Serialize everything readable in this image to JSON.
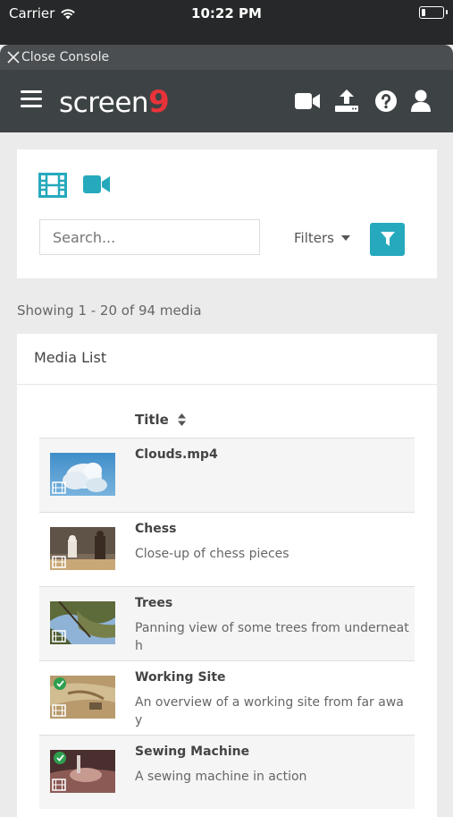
{
  "status_bar": {
    "carrier": "Carrier",
    "time": "10:22 PM"
  },
  "console": {
    "close_label": "Close Console"
  },
  "app": {
    "logo_text": "screen",
    "logo_number": "9"
  },
  "search": {
    "placeholder": "Search...",
    "value": ""
  },
  "filters": {
    "label": "Filters"
  },
  "summary": {
    "showing": "Showing 1 - 20 of 94 media"
  },
  "media_list": {
    "heading": "Media List",
    "column_title": "Title",
    "items": [
      {
        "title": "Clouds.mp4",
        "description": "",
        "published": false
      },
      {
        "title": "Chess",
        "description": "Close-up of chess pieces",
        "published": false
      },
      {
        "title": "Trees",
        "description": "Panning view of some trees from underneath",
        "published": false
      },
      {
        "title": "Working Site",
        "description": "An overview of a working site from far away",
        "published": true
      },
      {
        "title": "Sewing Machine",
        "description": "A sewing machine in action",
        "published": true
      }
    ]
  },
  "colors": {
    "accent": "#26a9bd",
    "appbar": "#3d4245",
    "statusbar": "#262829",
    "logo_red": "#e8333a",
    "check_green": "#2e9e4f"
  },
  "icons": [
    "wifi-icon",
    "battery-icon",
    "close-icon",
    "menu-icon",
    "video-camera-icon",
    "upload-icon",
    "help-icon",
    "user-icon",
    "film-icon",
    "filter-icon",
    "sort-icon",
    "check-icon"
  ]
}
